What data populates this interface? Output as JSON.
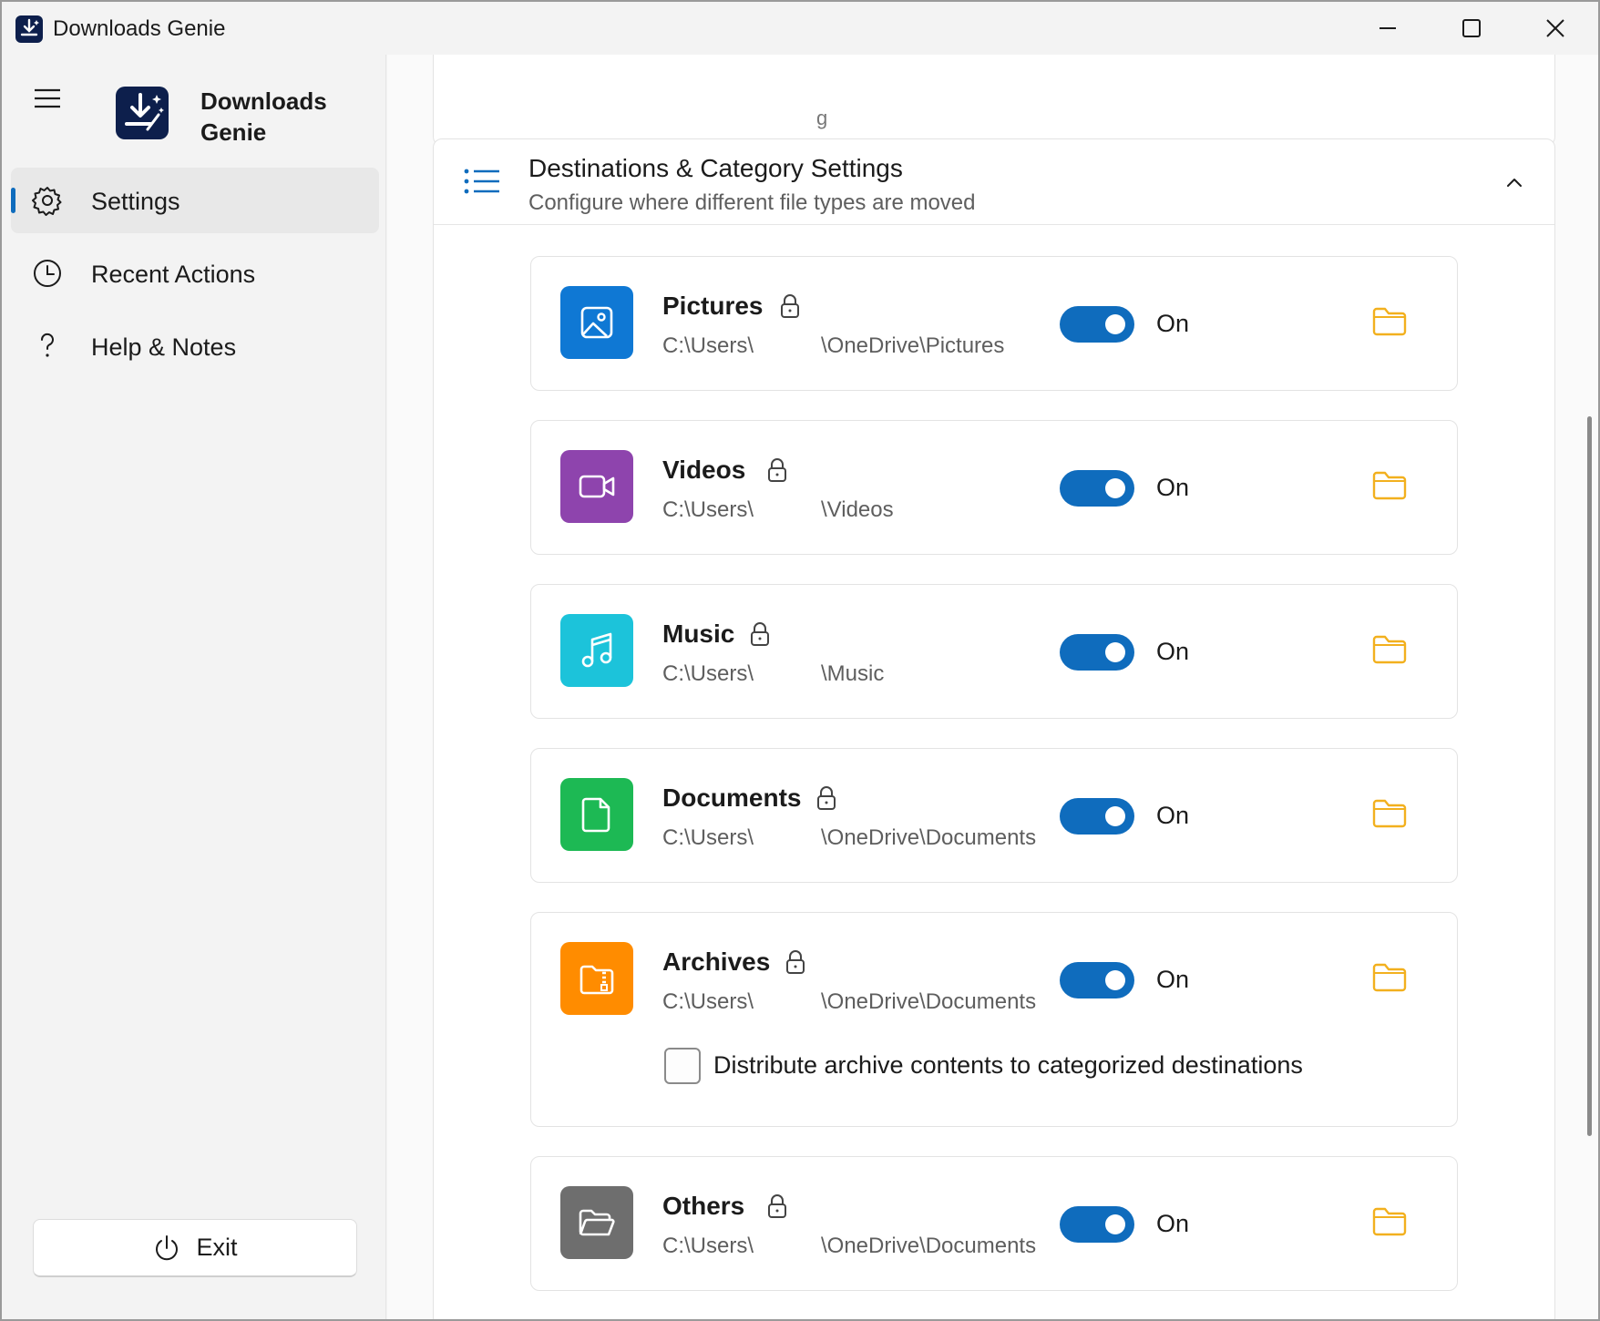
{
  "window": {
    "title": "Downloads Genie"
  },
  "sidebar": {
    "brand_line1": "Downloads",
    "brand_line2": "Genie",
    "items": [
      {
        "label": "Settings",
        "icon": "gear-icon",
        "active": true
      },
      {
        "label": "Recent Actions",
        "icon": "clock-icon",
        "active": false
      },
      {
        "label": "Help & Notes",
        "icon": "question-icon",
        "active": false
      }
    ],
    "exit_label": "Exit"
  },
  "section": {
    "title": "Destinations & Category Settings",
    "subtitle": "Configure where different file types are moved"
  },
  "categories": [
    {
      "name": "Pictures",
      "path_start": "C:\\Users\\",
      "path_end": "\\OneDrive\\Pictures",
      "toggle_label": "On",
      "color": "#0f78d4",
      "icon": "image-icon"
    },
    {
      "name": "Videos",
      "path_start": "C:\\Users\\",
      "path_end": "\\Videos",
      "toggle_label": "On",
      "color": "#8e44ad",
      "icon": "video-camera-icon"
    },
    {
      "name": "Music",
      "path_start": "C:\\Users\\",
      "path_end": "\\Music",
      "toggle_label": "On",
      "color": "#1cc3da",
      "icon": "music-note-icon"
    },
    {
      "name": "Documents",
      "path_start": "C:\\Users\\",
      "path_end": "\\OneDrive\\Documents",
      "toggle_label": "On",
      "color": "#1db954",
      "icon": "document-icon"
    },
    {
      "name": "Archives",
      "path_start": "C:\\Users\\",
      "path_end": "\\OneDrive\\Documents",
      "toggle_label": "On",
      "color": "#ff8c00",
      "icon": "archive-icon",
      "option_label": "Distribute archive contents to categorized destinations",
      "option_checked": false
    },
    {
      "name": "Others",
      "path_start": "C:\\Users\\",
      "path_end": "\\OneDrive\\Documents",
      "toggle_label": "On",
      "color": "#6e6e6e",
      "icon": "folder-open-icon"
    }
  ],
  "colors": {
    "accent": "#0f6cbd",
    "folder": "#f2b01e"
  }
}
